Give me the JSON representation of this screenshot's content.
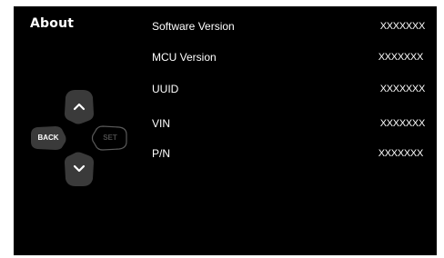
{
  "screen": {
    "title": "About"
  },
  "dpad": {
    "up_icon": "chevron-up-icon",
    "down_icon": "chevron-down-icon",
    "back_label": "BACK",
    "set_label": "SET"
  },
  "info": {
    "rows": [
      {
        "label": "Software Version",
        "value": "XXXXXXX"
      },
      {
        "label": "MCU Version",
        "value": "XXXXXXX"
      },
      {
        "label": "UUID",
        "value": "XXXXXXX"
      },
      {
        "label": "VIN",
        "value": "XXXXXXX"
      },
      {
        "label": "P/N",
        "value": "XXXXXXX"
      }
    ]
  },
  "colors": {
    "background": "#000000",
    "text": "#ffffff",
    "button_fill": "#3a3a3a",
    "set_outline": "#5a5a5a"
  }
}
